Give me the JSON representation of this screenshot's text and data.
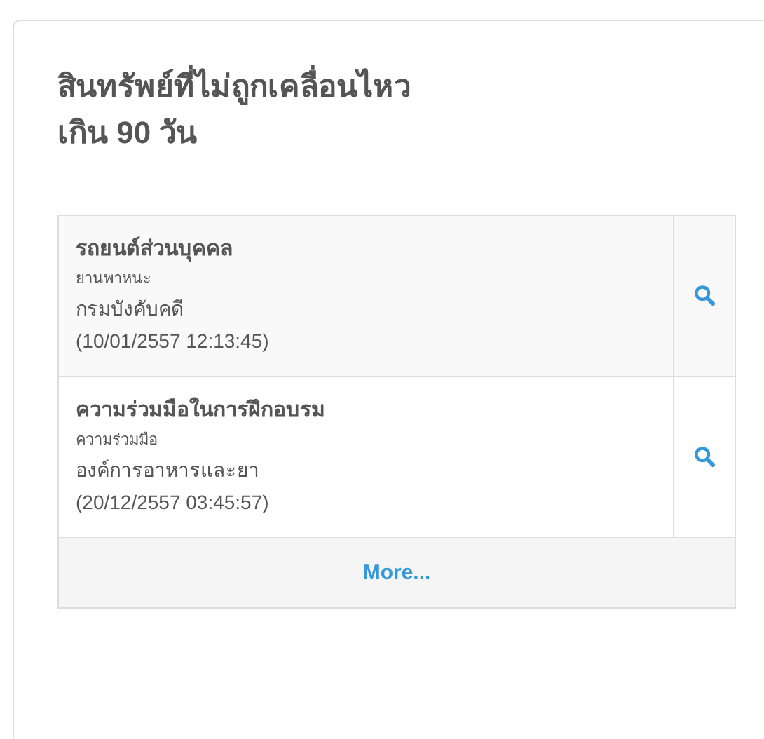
{
  "panel": {
    "title": "สินทรัพย์ที่ไม่ถูกเคลื่อนไหว\nเกิน 90 วัน"
  },
  "rows": [
    {
      "name": "รถยนต์ส่วนบุคคล",
      "category": "ยานพาหนะ",
      "department": "กรมบังคับคดี",
      "timestamp": "(10/01/2557 12:13:45)"
    },
    {
      "name": "ความร่วมมือในการฝึกอบรม",
      "category": "ความร่วมมือ",
      "department": "องค์การอาหารและยา",
      "timestamp": "(20/12/2557 03:45:57)"
    }
  ],
  "more_link": "More..."
}
